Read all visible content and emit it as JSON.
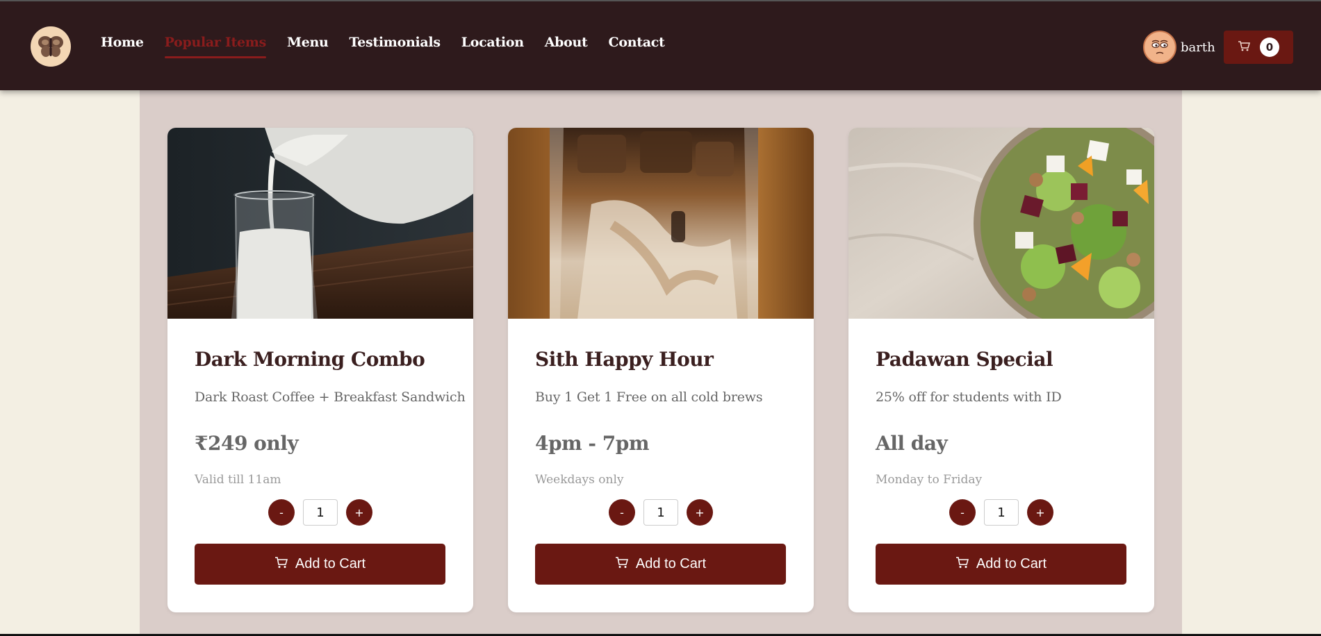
{
  "nav": {
    "items": [
      {
        "label": "Home"
      },
      {
        "label": "Popular Items",
        "active": true
      },
      {
        "label": "Menu"
      },
      {
        "label": "Testimonials"
      },
      {
        "label": "Location"
      },
      {
        "label": "About"
      },
      {
        "label": "Contact"
      }
    ]
  },
  "user": {
    "name": "barth"
  },
  "cart": {
    "count": "0",
    "icon": "cart-icon"
  },
  "colors": {
    "header": "#2e1a1c",
    "accent": "#6a1812",
    "active_nav": "#8a1c1c",
    "panel": "#dacdc9",
    "page": "#f3efe3"
  },
  "cards": [
    {
      "title": "Dark Morning Combo",
      "description": "Dark Roast Coffee + Breakfast Sandwich",
      "price": "₹249 only",
      "note": "Valid till 11am",
      "quantity": "1",
      "minus": "-",
      "plus": "+",
      "button": "Add to Cart",
      "image": "milk-pour-photo"
    },
    {
      "title": "Sith Happy Hour",
      "description": "Buy 1 Get 1 Free on all cold brews",
      "price": "4pm - 7pm",
      "note": "Weekdays only",
      "quantity": "1",
      "minus": "-",
      "plus": "+",
      "button": "Add to Cart",
      "image": "iced-coffee-photo"
    },
    {
      "title": "Padawan Special",
      "description": "25% off for students with ID",
      "price": "All day",
      "note": "Monday to Friday",
      "quantity": "1",
      "minus": "-",
      "plus": "+",
      "button": "Add to Cart",
      "image": "salad-bowl-photo"
    }
  ]
}
